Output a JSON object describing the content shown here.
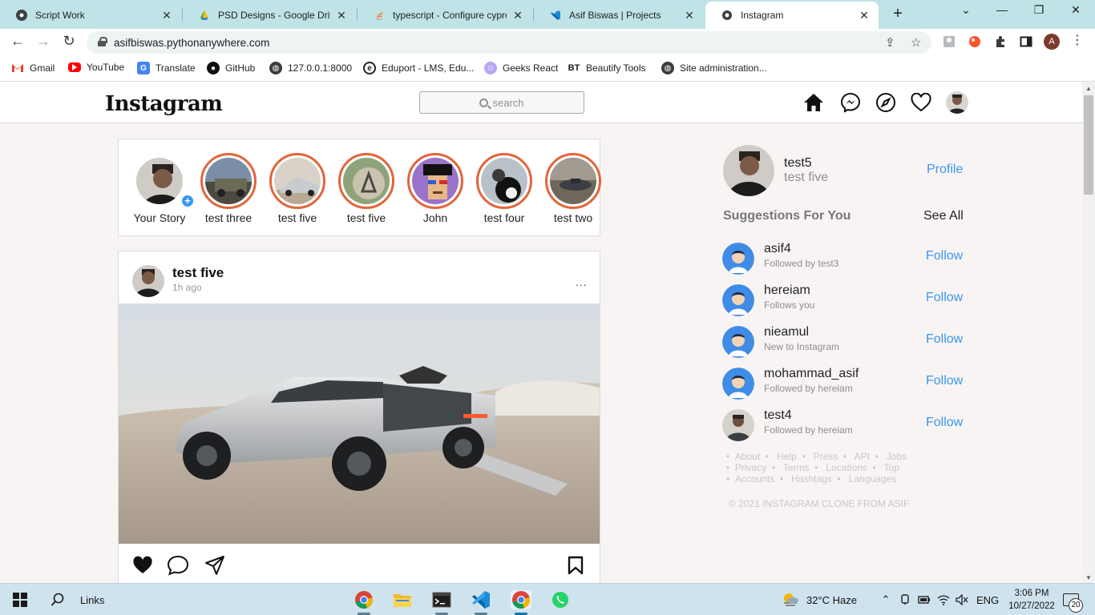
{
  "browser": {
    "tabs": [
      {
        "title": "Script Work",
        "icon": "chrome-icon"
      },
      {
        "title": "PSD Designs - Google Drive",
        "icon": "google-drive-icon"
      },
      {
        "title": "typescript - Configure cypress",
        "icon": "stackoverflow-icon"
      },
      {
        "title": "Asif Biswas | Projects",
        "icon": "vscode-icon"
      },
      {
        "title": "Instagram",
        "icon": "chrome-icon"
      }
    ],
    "active_tab": 4,
    "url": "asifbiswas.pythonanywhere.com",
    "profile_initial": "A",
    "bookmarks": [
      {
        "label": "Gmail",
        "icon": "gmail-icon"
      },
      {
        "label": "YouTube",
        "icon": "youtube-icon"
      },
      {
        "label": "Translate",
        "icon": "translate-icon"
      },
      {
        "label": "GitHub",
        "icon": "github-icon"
      },
      {
        "label": "127.0.0.1:8000",
        "icon": "globe-icon"
      },
      {
        "label": "Eduport - LMS, Edu...",
        "icon": "eduport-icon"
      },
      {
        "label": "Geeks React",
        "icon": "geeks-icon"
      },
      {
        "label": "Beautify Tools",
        "icon": "bt-icon"
      },
      {
        "label": "Site administration...",
        "icon": "globe-icon"
      }
    ]
  },
  "app": {
    "logo": "Instagram",
    "search_placeholder": "search",
    "stories": [
      {
        "name": "Your Story",
        "own": true
      },
      {
        "name": "test three"
      },
      {
        "name": "test five"
      },
      {
        "name": "test five"
      },
      {
        "name": "John"
      },
      {
        "name": "test four"
      },
      {
        "name": "test two"
      }
    ],
    "post": {
      "user": "test five",
      "time": "1h ago",
      "more": "..."
    },
    "me": {
      "username": "test5",
      "name": "test five",
      "profile_label": "Profile"
    },
    "suggestions_title": "Suggestions For You",
    "see_all": "See All",
    "suggestions": [
      {
        "username": "asif4",
        "sub": "Followed by test3",
        "action": "Follow"
      },
      {
        "username": "hereiam",
        "sub": "Follows you",
        "action": "Follow"
      },
      {
        "username": "nieamul",
        "sub": "New to Instagram",
        "action": "Follow"
      },
      {
        "username": "mohammad_asif",
        "sub": "Followed by hereiam",
        "action": "Follow"
      },
      {
        "username": "test4",
        "sub": "Followed by hereiam",
        "action": "Follow"
      }
    ],
    "footer_links": [
      "About",
      "Help",
      "Press",
      "API",
      "Jobs",
      "Privacy",
      "Terms",
      "Locations",
      "Top",
      "Accounts",
      "Hashtags",
      "Languages"
    ],
    "copyright": "© 2021 INSTAGRAM CLONE FROM ASIF"
  },
  "taskbar": {
    "search_label": "Links",
    "weather": "32°C  Haze",
    "language": "ENG",
    "time": "3:06 PM",
    "date": "10/27/2022",
    "notifications": "20"
  },
  "colors": {
    "link_blue": "#3897f0",
    "story_ring": "#e2653a",
    "tab_strip": "#bfe3e6"
  }
}
